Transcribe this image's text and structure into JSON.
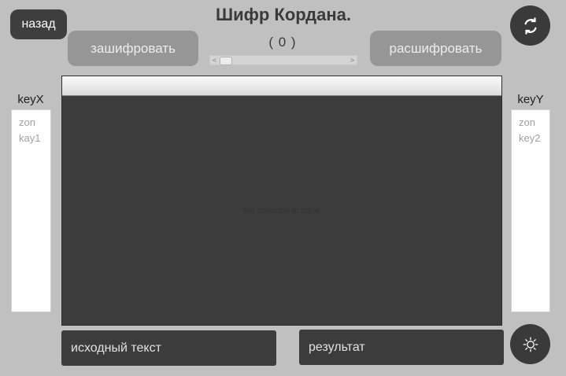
{
  "header": {
    "title": "Шифр Кордана.",
    "counter": "( 0 )",
    "back_label": "назад",
    "encrypt_label": "зашифровать",
    "decrypt_label": "расшифровать"
  },
  "slider": {
    "value": 0
  },
  "key_x": {
    "label": "keyX",
    "items": [
      "zon",
      "kay1"
    ]
  },
  "key_y": {
    "label": "keyY",
    "items": [
      "zon",
      "key2"
    ]
  },
  "table": {
    "empty_message": "No columns in table"
  },
  "inputs": {
    "source_placeholder": "исходный текст",
    "result_placeholder": "результат"
  },
  "icons": {
    "refresh": "refresh-icon",
    "settings": "settings-icon"
  },
  "colors": {
    "background": "#c0c0c0",
    "dark": "#3c3c3c",
    "button_gray": "#969696"
  }
}
